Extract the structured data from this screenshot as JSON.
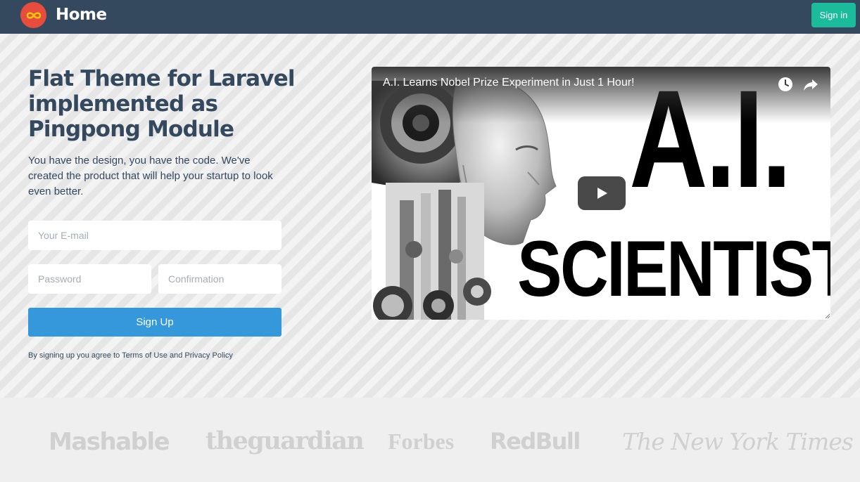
{
  "navbar": {
    "title": "Home",
    "signin_label": "Sign in",
    "logo_icon": "infinity-icon",
    "colors": {
      "background": "#34495e",
      "logo": "#e74c3c",
      "signin": "#1abc9c"
    }
  },
  "hero": {
    "title": "Flat Theme for Laravel implemented as Pingpong Module",
    "description": "You have the design, you have the code. We've created the product that will help your startup to look even better.",
    "form": {
      "email_placeholder": "Your E-mail",
      "password_placeholder": "Password",
      "confirmation_placeholder": "Confirmation",
      "submit_label": "Sign Up"
    },
    "terms": "By signing up you agree to Terms of Use and Privacy Policy",
    "colors": {
      "text": "#34495e",
      "submit": "#3498db"
    }
  },
  "video": {
    "title": "A.I. Learns Nobel Prize Experiment in Just 1 Hour!",
    "thumbnail_big_text": "A.I.",
    "thumbnail_small_text": "SCIENTIST",
    "icons": [
      "clock-icon",
      "share-icon",
      "play-icon"
    ]
  },
  "press_logos": [
    "Mashable",
    "theguardian",
    "Forbes",
    "RedBull",
    "The New York Times"
  ]
}
